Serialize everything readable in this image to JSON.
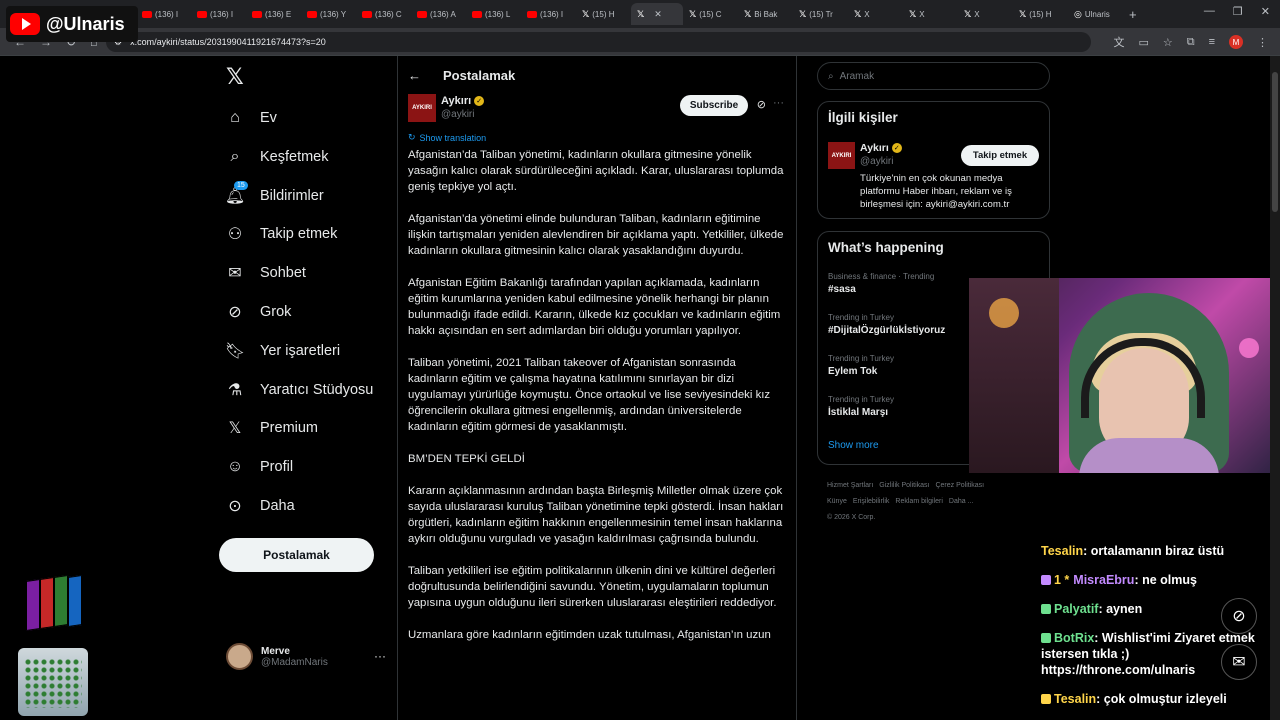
{
  "overlay": {
    "channel": "@Ulnaris"
  },
  "browser": {
    "tabs": [
      {
        "label": "(136) I",
        "type": "yt"
      },
      {
        "label": "(136) I",
        "type": "yt"
      },
      {
        "label": "(136) E",
        "type": "yt"
      },
      {
        "label": "(136) Y",
        "type": "yt"
      },
      {
        "label": "(136) C",
        "type": "yt"
      },
      {
        "label": "(136) A",
        "type": "yt"
      },
      {
        "label": "(136) L",
        "type": "yt"
      },
      {
        "label": "(136) I",
        "type": "yt"
      },
      {
        "label": "(15) H",
        "type": "x"
      },
      {
        "label": "",
        "type": "x",
        "active": true
      },
      {
        "label": "(15) C",
        "type": "x"
      },
      {
        "label": "Bi Bak",
        "type": "x"
      },
      {
        "label": "(15) Tr",
        "type": "x"
      },
      {
        "label": "X",
        "type": "x"
      },
      {
        "label": "X",
        "type": "x"
      },
      {
        "label": "X",
        "type": "x"
      },
      {
        "label": "(15) H",
        "type": "x"
      },
      {
        "label": "Ulnaris",
        "type": "web"
      }
    ],
    "url": "x.com/aykiri/status/2031990411921674473?s=20",
    "profile_letter": "M"
  },
  "nav": {
    "items": [
      {
        "label": "Ev",
        "icon": "home-icon"
      },
      {
        "label": "Keşfetmek",
        "icon": "search-icon"
      },
      {
        "label": "Bildirimler",
        "icon": "bell-icon",
        "badge": "15"
      },
      {
        "label": "Takip etmek",
        "icon": "add-person-icon"
      },
      {
        "label": "Sohbet",
        "icon": "mail-icon"
      },
      {
        "label": "Grok",
        "icon": "grok-icon"
      },
      {
        "label": "Yer işaretleri",
        "icon": "bookmark-icon"
      },
      {
        "label": "Yaratıcı Stüdyosu",
        "icon": "flask-icon"
      },
      {
        "label": "Premium",
        "icon": "x-icon"
      },
      {
        "label": "Profil",
        "icon": "person-icon"
      },
      {
        "label": "Daha",
        "icon": "more-circle-icon"
      }
    ],
    "post_button": "Postalamak",
    "account": {
      "name": "Merve",
      "handle": "@MadamNaris"
    }
  },
  "main": {
    "title": "Postalamak",
    "post": {
      "author": "Aykırı",
      "handle": "@aykiri",
      "avatar_text": "AYKIRI",
      "subscribe": "Subscribe",
      "show_translation": "Show translation",
      "paragraphs": [
        "Afganistan’da Taliban yönetimi, kadınların okullara gitmesine yönelik yasağın kalıcı olarak sürdürüleceğini açıkladı. Karar, uluslararası toplumda geniş tepkiye yol açtı.",
        "Afganistan’da yönetimi elinde bulunduran Taliban, kadınların eğitimine ilişkin tartışmaları yeniden alevlendiren bir açıklama yaptı. Yetkililer, ülkede kadınların okullara gitmesinin kalıcı olarak yasaklandığını duyurdu.",
        "Afganistan Eğitim Bakanlığı tarafından yapılan açıklamada, kadınların eğitim kurumlarına yeniden kabul edilmesine yönelik herhangi bir planın bulunmadığı ifade edildi. Kararın, ülkede kız çocukları ve kadınların eğitim hakkı açısından en sert adımlardan biri olduğu yorumları yapılıyor.",
        "Taliban yönetimi, 2021 Taliban takeover of Afganistan sonrasında kadınların eğitim ve çalışma hayatına katılımını sınırlayan bir dizi uygulamayı yürürlüğe koymuştu. Önce ortaokul ve lise seviyesindeki kız öğrencilerin okullara gitmesi engellenmiş, ardından üniversitelerde kadınların eğitim görmesi de yasaklanmıştı.",
        "BM’DEN TEPKİ GELDİ",
        "Kararın açıklanmasının ardından başta Birleşmiş Milletler olmak üzere çok sayıda uluslararası kuruluş Taliban yönetimine tepki gösterdi. İnsan hakları örgütleri, kadınların eğitim hakkının engellenmesinin temel insan haklarına aykırı olduğunu vurguladı ve yasağın kaldırılması çağrısında bulundu.",
        "Taliban yetkilileri ise eğitim politikalarının ülkenin dini ve kültürel değerleri doğrultusunda belirlendiğini savundu. Yönetim, uygulamaların toplumun yapısına uygun olduğunu ileri sürerken uluslararası eleştirileri reddediyor.",
        "Uzmanlara göre kadınların eğitimden uzak tutulması, Afganistan’ın uzun"
      ]
    }
  },
  "right": {
    "search_placeholder": "Aramak",
    "related_title": "İlgili kişiler",
    "related": {
      "name": "Aykırı",
      "handle": "@aykiri",
      "avatar_text": "AYKIRI",
      "follow": "Takip etmek",
      "bio": "Türkiye'nin en çok okunan medya platformu Haber ihbarı, reklam ve iş birleşmesi için: aykiri@aykiri.com.tr"
    },
    "happening_title": "What’s happening",
    "trends": [
      {
        "meta": "Business & finance · Trending",
        "name": "#sasa"
      },
      {
        "meta": "Trending in Turkey",
        "name": "#DijitalÖzgürlükİstiyoruz"
      },
      {
        "meta": "Trending in Turkey",
        "name": "Eylem Tok"
      },
      {
        "meta": "Trending in Turkey",
        "name": "İstiklal Marşı"
      }
    ],
    "show_more": "Show more",
    "footer": [
      "Hizmet Şartları",
      "Gizlilik Politikası",
      "Çerez Politikası",
      "Künye",
      "Erişilebilirlik",
      "Reklam bilgileri",
      "Daha ...",
      "© 2026 X Corp."
    ]
  },
  "chat": [
    {
      "user": "Tesalin",
      "color": "yellow",
      "text": ": ortalamanın biraz üstü",
      "badge": ""
    },
    {
      "user": "MisraEbru",
      "color": "purple",
      "text": ": ne olmuş",
      "badge": "1 *"
    },
    {
      "user": "Palyatif",
      "color": "green",
      "text": ": aynen",
      "badge": ""
    },
    {
      "user": "BotRix",
      "color": "green",
      "text": ": Wishlist'imi Ziyaret etmek istersen tıkla ;) https://throne.com/ulnaris",
      "badge": ""
    },
    {
      "user": "Tesalin",
      "color": "yellow",
      "text": ": çok olmuştur izleyeli",
      "badge": ""
    }
  ]
}
